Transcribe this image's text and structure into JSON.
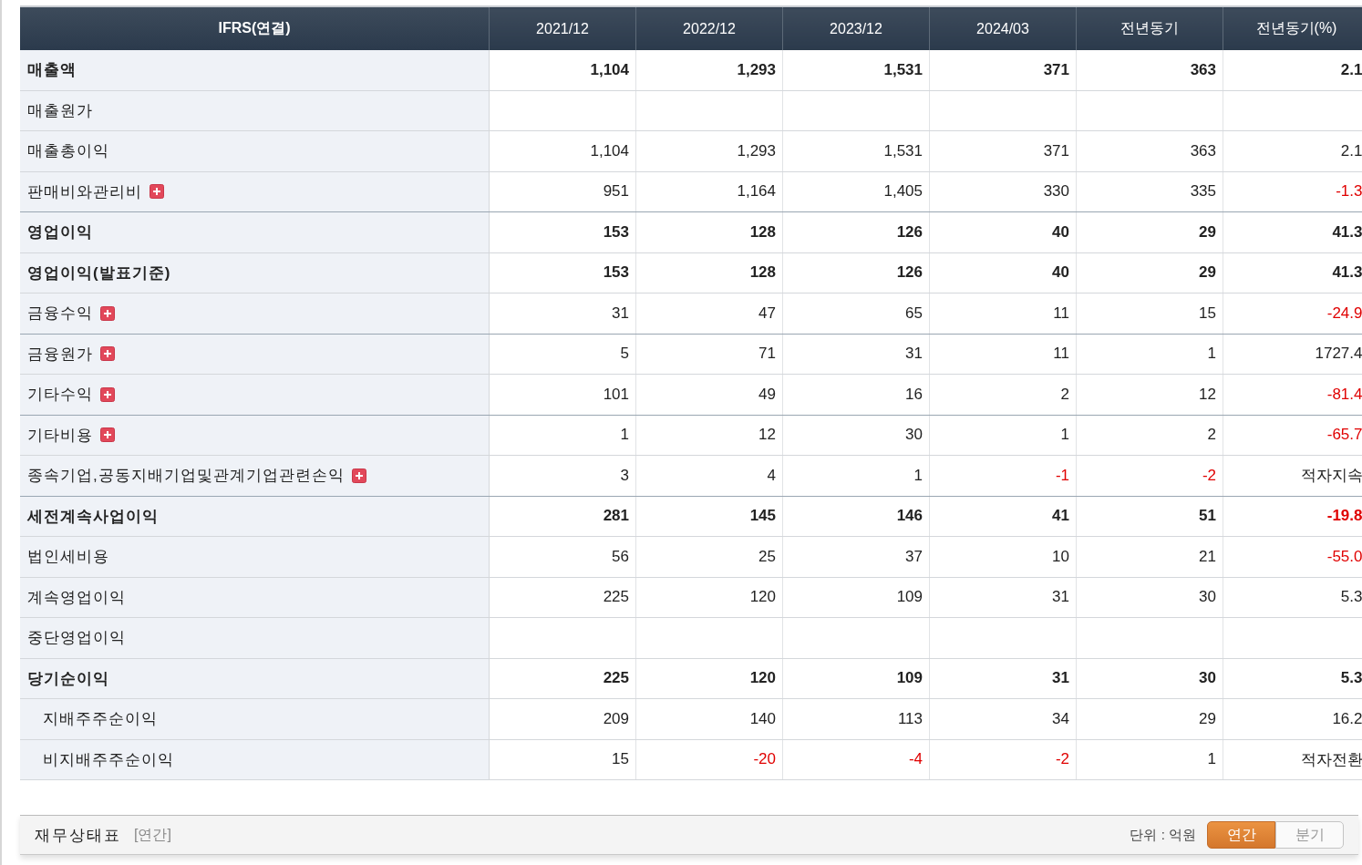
{
  "table": {
    "columns": [
      "IFRS(연결)",
      "2021/12",
      "2022/12",
      "2023/12",
      "2024/03",
      "전년동기",
      "전년동기(%)"
    ],
    "rows": [
      {
        "label": "매출액",
        "bold": true,
        "expandable": false,
        "group_end": false,
        "values": [
          "1,104",
          "1,293",
          "1,531",
          "371",
          "363",
          "2.1"
        ]
      },
      {
        "label": "매출원가",
        "bold": false,
        "expandable": false,
        "group_end": false
      },
      {
        "label": "매출총이익",
        "bold": false,
        "expandable": false,
        "group_end": false,
        "values": [
          "1,104",
          "1,293",
          "1,531",
          "371",
          "363",
          "2.1"
        ]
      },
      {
        "label": "판매비와관리비",
        "bold": false,
        "expandable": true,
        "group_end": true,
        "values": [
          "951",
          "1,164",
          "1,405",
          "330",
          "335",
          "-1.3"
        ],
        "red": [
          false,
          false,
          false,
          false,
          false,
          true
        ]
      },
      {
        "label": "영업이익",
        "bold": true,
        "expandable": false,
        "group_end": false,
        "values": [
          "153",
          "128",
          "126",
          "40",
          "29",
          "41.3"
        ]
      },
      {
        "label": "영업이익(발표기준)",
        "bold": true,
        "expandable": false,
        "group_end": false,
        "values": [
          "153",
          "128",
          "126",
          "40",
          "29",
          "41.3"
        ]
      },
      {
        "label": "금융수익",
        "bold": false,
        "expandable": true,
        "group_end": true,
        "values": [
          "31",
          "47",
          "65",
          "11",
          "15",
          "-24.9"
        ],
        "red": [
          false,
          false,
          false,
          false,
          false,
          true
        ]
      },
      {
        "label": "금융원가",
        "bold": false,
        "expandable": true,
        "group_end": false,
        "values": [
          "5",
          "71",
          "31",
          "11",
          "1",
          "1727.4"
        ]
      },
      {
        "label": "기타수익",
        "bold": false,
        "expandable": true,
        "group_end": true,
        "values": [
          "101",
          "49",
          "16",
          "2",
          "12",
          "-81.4"
        ],
        "red": [
          false,
          false,
          false,
          false,
          false,
          true
        ]
      },
      {
        "label": "기타비용",
        "bold": false,
        "expandable": true,
        "group_end": false,
        "values": [
          "1",
          "12",
          "30",
          "1",
          "2",
          "-65.7"
        ],
        "red": [
          false,
          false,
          false,
          false,
          false,
          true
        ]
      },
      {
        "label": "종속기업,공동지배기업및관계기업관련손익",
        "bold": false,
        "expandable": true,
        "group_end": true,
        "values": [
          "3",
          "4",
          "1",
          "-1",
          "-2",
          "적자지속"
        ],
        "red": [
          false,
          false,
          false,
          true,
          true,
          false
        ]
      },
      {
        "label": "세전계속사업이익",
        "bold": true,
        "expandable": false,
        "group_end": false,
        "values": [
          "281",
          "145",
          "146",
          "41",
          "51",
          "-19.8"
        ],
        "red": [
          false,
          false,
          false,
          false,
          false,
          true
        ]
      },
      {
        "label": "법인세비용",
        "bold": false,
        "expandable": false,
        "group_end": false,
        "values": [
          "56",
          "25",
          "37",
          "10",
          "21",
          "-55.0"
        ],
        "red": [
          false,
          false,
          false,
          false,
          false,
          true
        ]
      },
      {
        "label": "계속영업이익",
        "bold": false,
        "expandable": false,
        "group_end": false,
        "values": [
          "225",
          "120",
          "109",
          "31",
          "30",
          "5.3"
        ]
      },
      {
        "label": "중단영업이익",
        "bold": false,
        "expandable": false,
        "group_end": false
      },
      {
        "label": "당기순이익",
        "bold": true,
        "expandable": false,
        "group_end": false,
        "values": [
          "225",
          "120",
          "109",
          "31",
          "30",
          "5.3"
        ],
        "children": [
          {
            "label": "지배주주순이익",
            "bold": false,
            "expandable": false,
            "group_end": false,
            "values": [
              "209",
              "140",
              "113",
              "34",
              "29",
              "16.2"
            ]
          },
          {
            "label": "비지배주주순이익",
            "bold": false,
            "expandable": false,
            "group_end": false,
            "values": [
              "15",
              "-20",
              "-4",
              "-2",
              "1",
              "적자전환"
            ],
            "red": [
              false,
              true,
              true,
              true,
              false,
              false
            ]
          }
        ]
      }
    ]
  },
  "next_section": {
    "title": "재무상태표",
    "period": "[연간]",
    "unit": "단위 : 억원",
    "toggle": [
      {
        "label": "연간",
        "selected": true
      },
      {
        "label": "분기",
        "selected": false
      }
    ]
  }
}
